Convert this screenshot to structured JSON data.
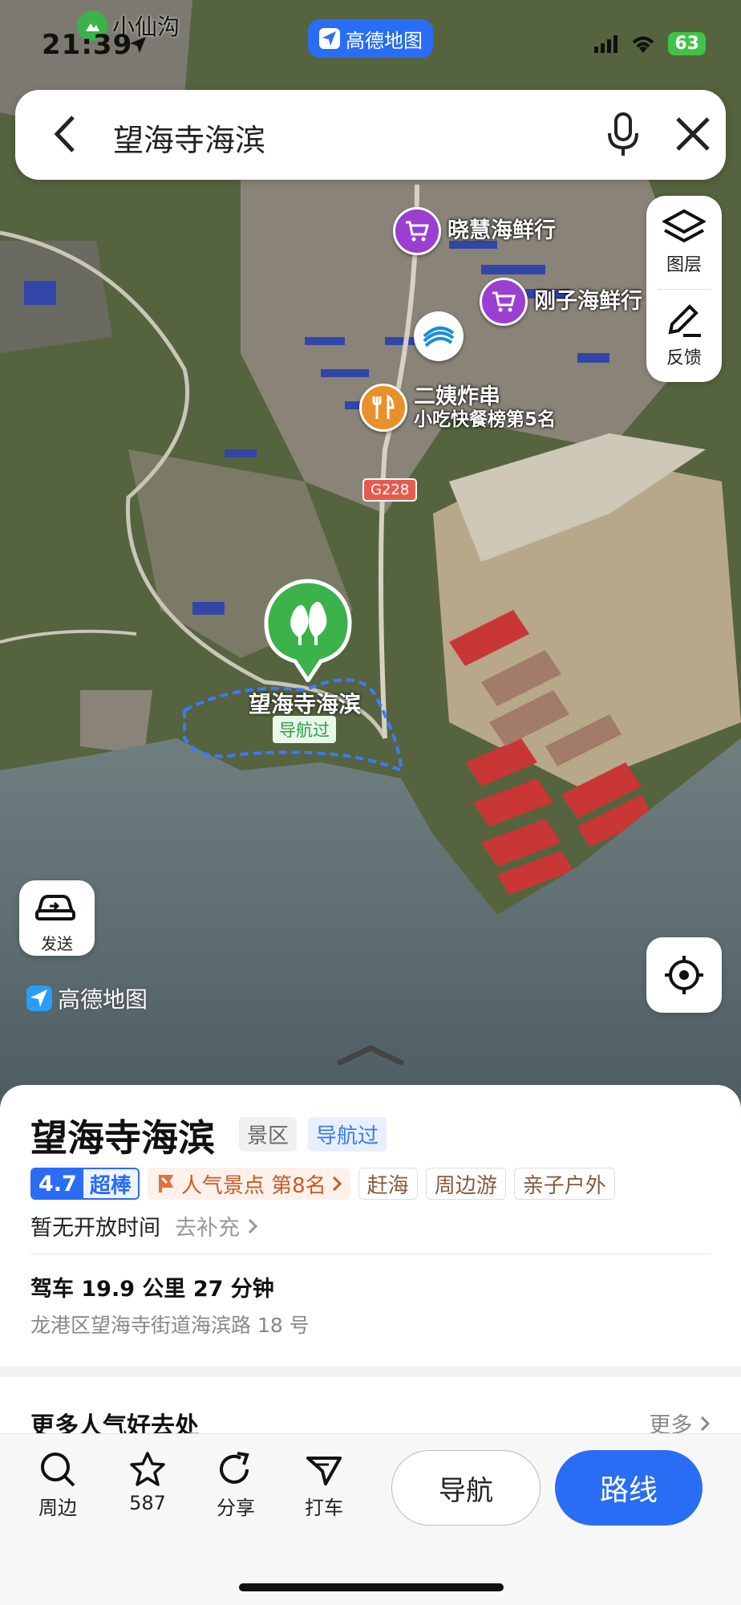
{
  "status_bar": {
    "time": "21:39",
    "back_app": "小仙沟",
    "island_label": "高德地图",
    "battery": "63"
  },
  "search": {
    "query": "望海寺海滨"
  },
  "side_panel": {
    "layers_label": "图层",
    "feedback_label": "反馈"
  },
  "map": {
    "send_label": "发送",
    "logo_label": "高德地图",
    "road_tag": "G228",
    "pois": [
      {
        "name": "晓慧海鲜行",
        "icon": "shopping-cart-icon",
        "color": "#9b3fd0"
      },
      {
        "name": "刚子海鲜行",
        "icon": "shopping-cart-icon",
        "color": "#9b3fd0"
      },
      {
        "name": "二姨炸串",
        "sub": "小吃快餐榜第5名",
        "icon": "fork-knife-icon",
        "color": "#e8912a"
      }
    ],
    "main_marker": {
      "label": "望海寺海滨",
      "tag": "导航过",
      "color": "#3bb34a"
    }
  },
  "place": {
    "title": "望海寺海滨",
    "category": "景区",
    "visited_tag": "导航过",
    "rating": "4.7",
    "rating_word": "超棒",
    "rank_text": "人气景点 第8名",
    "chips": [
      "赶海",
      "周边游",
      "亲子户外"
    ],
    "hours": "暂无开放时间",
    "hours_action": "去补充",
    "drive": "驾车 19.9 公里 27 分钟",
    "address": "龙港区望海寺街道海滨路 18 号"
  },
  "more_section": {
    "heading": "更多人气好去处",
    "more_label": "更多"
  },
  "toolbar": {
    "nearby": "周边",
    "favorites": "587",
    "share": "分享",
    "taxi": "打车",
    "navigate": "导航",
    "route": "路线"
  }
}
